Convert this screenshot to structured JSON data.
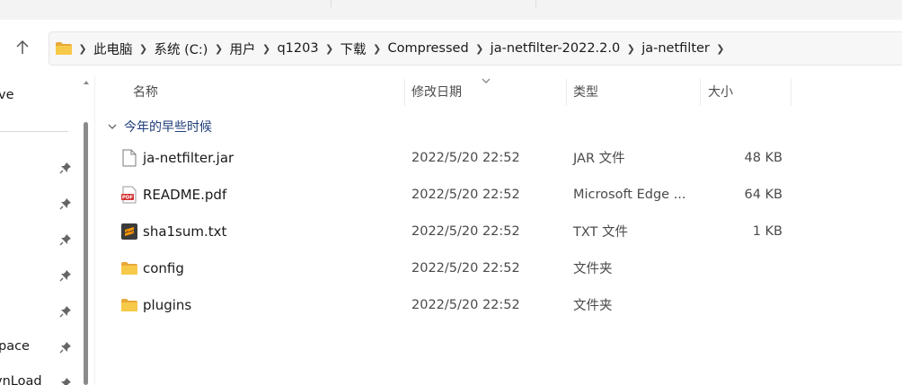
{
  "address_bar": {
    "breadcrumbs": [
      "此电脑",
      "系统 (C:)",
      "用户",
      "q1203",
      "下载",
      "Compressed",
      "ja-netfilter-2022.2.0",
      "ja-netfilter"
    ]
  },
  "nav_pane": {
    "items": [
      {
        "label": "ve",
        "icon": "onedrive"
      },
      {
        "label": "",
        "icon": "pin-icon"
      },
      {
        "label": "",
        "icon": "pin-icon"
      },
      {
        "label": "",
        "icon": "pin-icon"
      },
      {
        "label": "",
        "icon": "pin-icon"
      },
      {
        "label": "",
        "icon": "pin-icon"
      },
      {
        "label": "pace",
        "icon": "pin-icon"
      },
      {
        "label": "vnLoad",
        "icon": "pin-icon"
      }
    ]
  },
  "columns": {
    "name": "名称",
    "modified": "修改日期",
    "type": "类型",
    "size": "大小"
  },
  "group": {
    "label": "今年的早些时候"
  },
  "files": [
    {
      "name": "ja-netfilter.jar",
      "modified": "2022/5/20 22:52",
      "type": "JAR 文件",
      "size": "48 KB",
      "icon": "jar-file-icon"
    },
    {
      "name": "README.pdf",
      "modified": "2022/5/20 22:52",
      "type": "Microsoft Edge ...",
      "size": "64 KB",
      "icon": "pdf-file-icon"
    },
    {
      "name": "sha1sum.txt",
      "modified": "2022/5/20 22:52",
      "type": "TXT 文件",
      "size": "1 KB",
      "icon": "sublime-text-file-icon"
    },
    {
      "name": "config",
      "modified": "2022/5/20 22:52",
      "type": "文件夹",
      "size": "",
      "icon": "folder-icon"
    },
    {
      "name": "plugins",
      "modified": "2022/5/20 22:52",
      "type": "文件夹",
      "size": "",
      "icon": "folder-icon"
    }
  ],
  "colors": {
    "folder": "#f5c242",
    "group_label": "#1f3e7a",
    "pdf_red": "#d32f2f",
    "sublime_orange": "#ff9800"
  }
}
